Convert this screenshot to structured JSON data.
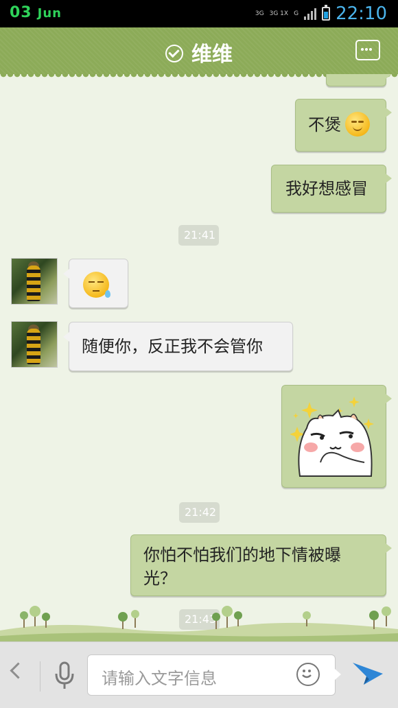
{
  "status_bar": {
    "date_day": "03",
    "date_month": "Jun",
    "network_labels": [
      "3G",
      "3G 1X",
      "G"
    ],
    "time": "22:10",
    "battery_level": 0.6
  },
  "header": {
    "title": "维维"
  },
  "messages": [
    {
      "type": "text",
      "side": "out",
      "text": "不煲"
    },
    {
      "type": "text",
      "side": "out",
      "text": "我好想感冒"
    },
    {
      "type": "time",
      "text": "21:41"
    },
    {
      "type": "emoji",
      "side": "in"
    },
    {
      "type": "text",
      "side": "in",
      "text": "随便你，反正我不会管你"
    },
    {
      "type": "sticker",
      "side": "out"
    },
    {
      "type": "time",
      "text": "21:42"
    },
    {
      "type": "text",
      "side": "out",
      "text": "你怕不怕我们的地下情被曝光？"
    },
    {
      "type": "time",
      "text": "21:43"
    }
  ],
  "input": {
    "placeholder": "请输入文字信息"
  },
  "colors": {
    "header_bg": "#8cab58",
    "outgoing_bubble": "#c4d6a2",
    "incoming_bubble": "#f2f2f2",
    "time_accent": "#4bb4ec",
    "send_icon": "#2e86d6"
  }
}
